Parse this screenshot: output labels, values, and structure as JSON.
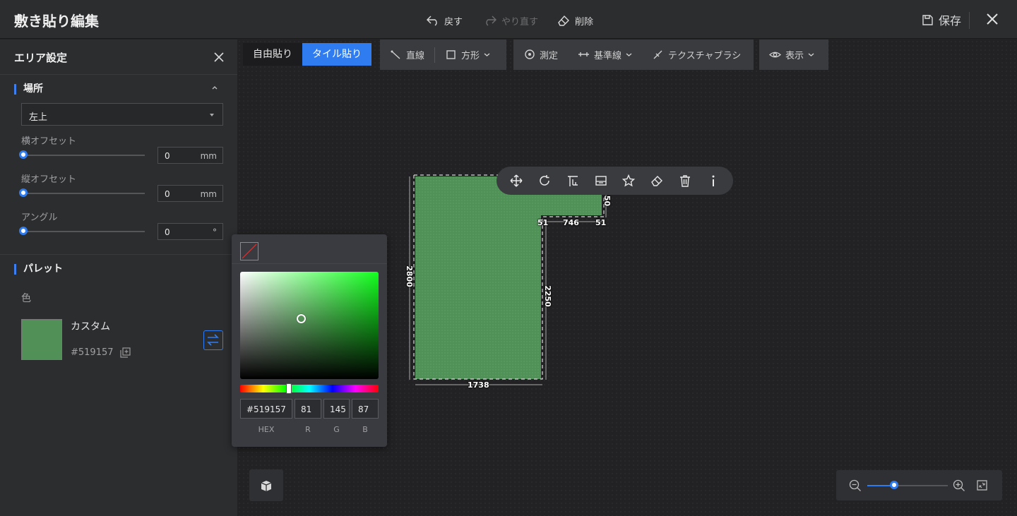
{
  "header": {
    "title": "敷き貼り編集",
    "undo_label": "戻す",
    "redo_label": "やり直す",
    "delete_label": "削除",
    "save_label": "保存"
  },
  "panel": {
    "title": "エリア設定",
    "location": {
      "section_title": "場所",
      "position_value": "左上",
      "h_offset_label": "横オフセット",
      "h_offset_value": "0",
      "h_offset_unit": "mm",
      "v_offset_label": "縦オフセット",
      "v_offset_value": "0",
      "v_offset_unit": "mm",
      "angle_label": "アングル",
      "angle_value": "0",
      "angle_unit": "°"
    },
    "palette": {
      "section_title": "パレット",
      "color_label": "色",
      "custom_name": "カスタム",
      "custom_hex": "#519157",
      "swatch_color": "#519157"
    }
  },
  "toolbar": {
    "free_paste_label": "自由貼り",
    "tile_paste_label": "タイル貼り",
    "line_label": "直線",
    "rect_label": "方形",
    "measure_label": "測定",
    "baseline_label": "基準線",
    "texture_brush_label": "テクスチャブラシ",
    "display_label": "表示"
  },
  "floorplan": {
    "fill_color": "#519157",
    "dim_top_right": "746",
    "dim_notch_left": "51",
    "dim_notch_right": "51",
    "dim_left": "2800",
    "dim_inner_right": "2250",
    "dim_bottom": "1738",
    "dim_right_small": "50"
  },
  "color_picker": {
    "hex_value": "#519157",
    "r_value": "81",
    "g_value": "145",
    "b_value": "87",
    "hex_label": "HEX",
    "r_label": "R",
    "g_label": "G",
    "b_label": "B"
  },
  "colors": {
    "accent": "#2f7cf0",
    "panel_bg": "#2c2d2f"
  }
}
